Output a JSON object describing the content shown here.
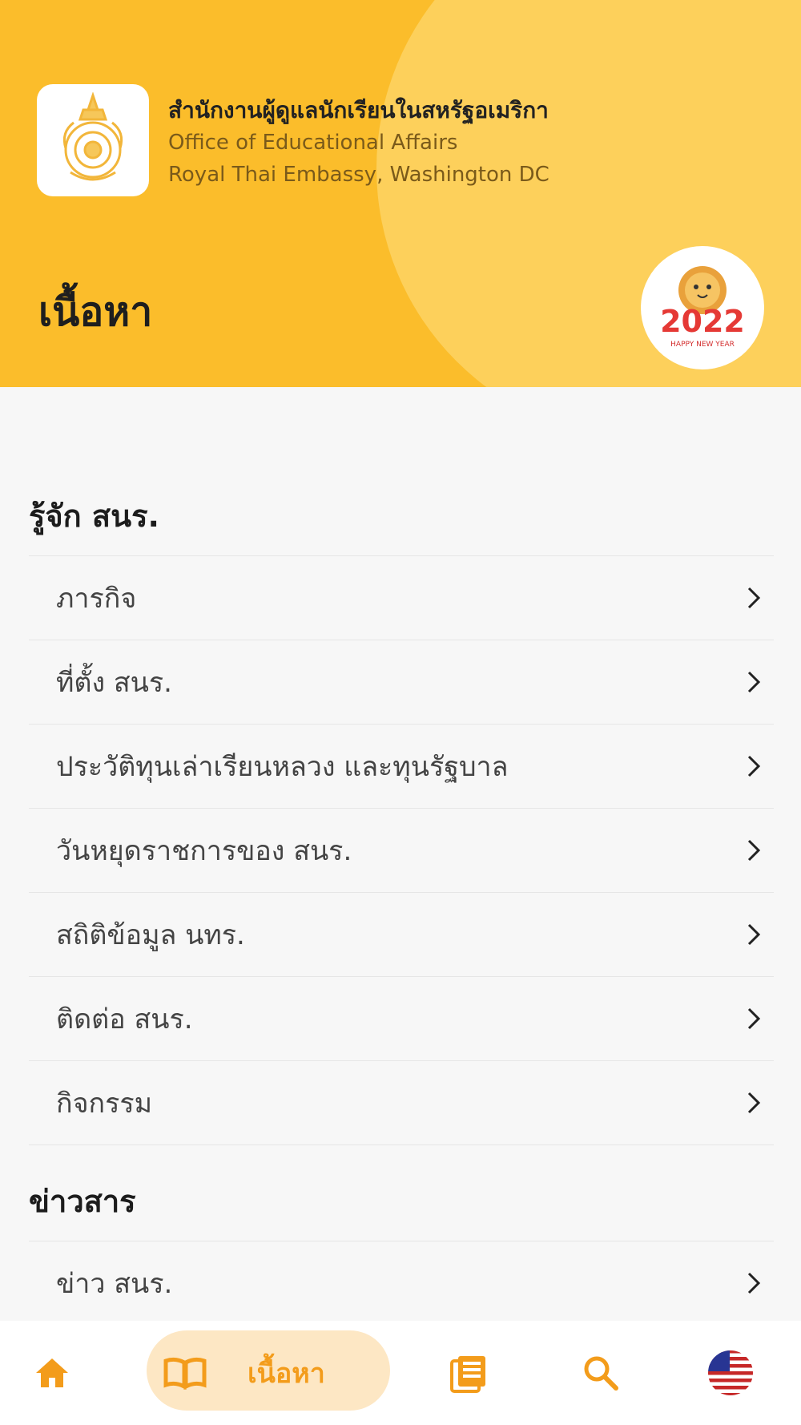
{
  "header": {
    "org_name_th": "สำนักงานผู้ดูแลนักเรียนในสหรัฐอเมริกา",
    "org_name_en": "Office of Educational Affairs",
    "org_subtitle": "Royal Thai Embassy, Washington DC",
    "page_title": "เนื้อหา",
    "avatar_badge": {
      "year": "2022",
      "caption": "HAPPY NEW YEAR"
    }
  },
  "sections": [
    {
      "title": "รู้จัก สนร.",
      "items": [
        {
          "label": "ภารกิจ"
        },
        {
          "label": "ที่ตั้ง สนร."
        },
        {
          "label": "ประวัติทุนเล่าเรียนหลวง และทุนรัฐบาล"
        },
        {
          "label": "วันหยุดราชการของ สนร."
        },
        {
          "label": "สถิติข้อมูล นทร."
        },
        {
          "label": "ติดต่อ สนร."
        },
        {
          "label": "กิจกรรม"
        }
      ]
    },
    {
      "title": "ข่าวสาร",
      "items": [
        {
          "label": "ข่าว สนร."
        }
      ]
    }
  ],
  "bottom_nav": {
    "active_label": "เนื้อหา",
    "items": [
      "home-icon",
      "book-icon",
      "news-icon",
      "search-icon",
      "us-flag-icon"
    ]
  },
  "colors": {
    "header_bg": "#fbbd2b",
    "accent": "#f39c1b",
    "active_pill": "#fde7c4"
  }
}
